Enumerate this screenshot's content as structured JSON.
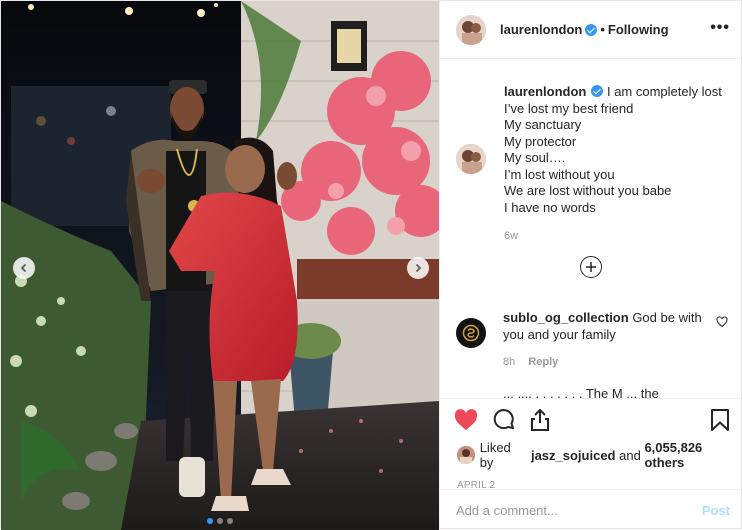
{
  "header": {
    "username": "laurenlondon",
    "separator": "•",
    "follow_status": "Following",
    "more_label": "•••"
  },
  "caption": {
    "username": "laurenlondon",
    "lines": [
      "I am completely lost",
      "I’ve lost my best friend",
      "My sanctuary",
      "My protector",
      "My soul….",
      "I’m lost without you",
      "We are lost without you babe",
      "I have no words"
    ],
    "time_ago": "6w"
  },
  "load_more": {
    "icon": "plus-circle-icon"
  },
  "comment": {
    "username": "sublo_og_collection",
    "text": "God be with you and your family",
    "time_ago": "8h",
    "reply_label": "Reply"
  },
  "next_comment_peek": "... ,,.. . .  . . . . ,  The M ,,, the",
  "actions": {
    "like_icon": "heart-filled-icon",
    "comment_icon": "comment-icon",
    "share_icon": "share-icon",
    "save_icon": "bookmark-icon"
  },
  "likes": {
    "prefix": "Liked by",
    "user": "jasz_sojuiced",
    "middle": "and",
    "count": "6,055,826 others"
  },
  "date": "APRIL 2",
  "add_comment": {
    "placeholder": "Add a comment...",
    "post_label": "Post"
  },
  "carousel": {
    "total": 3,
    "active": 0
  },
  "colors": {
    "accent_blue": "#3897f0",
    "like_red": "#ed4956",
    "muted_text": "#999999",
    "post_disabled": "#b3dbff"
  }
}
